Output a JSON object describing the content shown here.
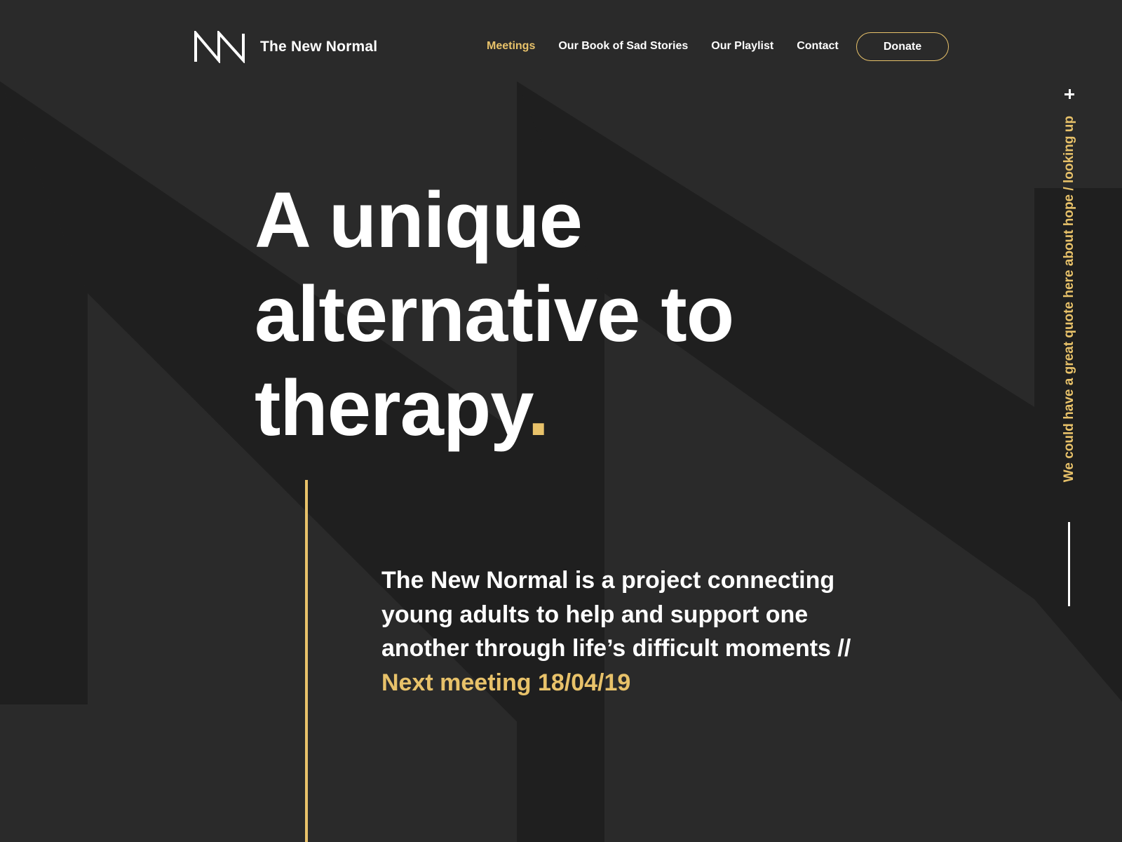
{
  "brand": {
    "name": "The New Normal",
    "logo_icon": "nn-monogram-icon"
  },
  "nav": {
    "items": [
      {
        "label": "Meetings",
        "active": true
      },
      {
        "label": "Our Book of Sad Stories",
        "active": false
      },
      {
        "label": "Our Playlist",
        "active": false
      },
      {
        "label": "Contact",
        "active": false
      }
    ],
    "donate_label": "Donate"
  },
  "hero": {
    "title_lines": [
      "A unique",
      "alternative to",
      "therapy"
    ],
    "title_accent": ".",
    "intro_text": "The New Normal is a project connecting young adults to help and support one another through life’s difficult moments // ",
    "next_meeting": "Next meeting 18/04/19"
  },
  "side": {
    "expand_icon": "plus-icon",
    "quote": "We could have a great quote here about hope / looking up"
  },
  "colors": {
    "background": "#2a2a2a",
    "background_shape": "#1f1f1f",
    "accent": "#e8c26a",
    "text": "#ffffff"
  }
}
